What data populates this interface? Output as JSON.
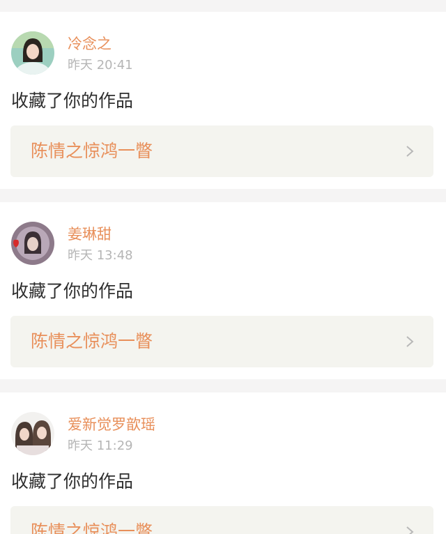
{
  "feed": [
    {
      "username": "冷念之",
      "time": "昨天 20:41",
      "action": "收藏了你的作品",
      "work_title": "陈情之惊鸿一瞥"
    },
    {
      "username": "姜琳甜",
      "time": "昨天 13:48",
      "action": "收藏了你的作品",
      "work_title": "陈情之惊鸿一瞥"
    },
    {
      "username": "爱新觉罗歆瑶",
      "time": "昨天 11:29",
      "action": "收藏了你的作品",
      "work_title": "陈情之惊鸿一瞥"
    }
  ],
  "colors": {
    "username": "#e88f5a",
    "time": "#b5b5b5",
    "link_bg": "#f4f4ef",
    "page_bg": "#f5f4f4"
  },
  "icons": [
    "avatar",
    "chevron-right-icon"
  ]
}
